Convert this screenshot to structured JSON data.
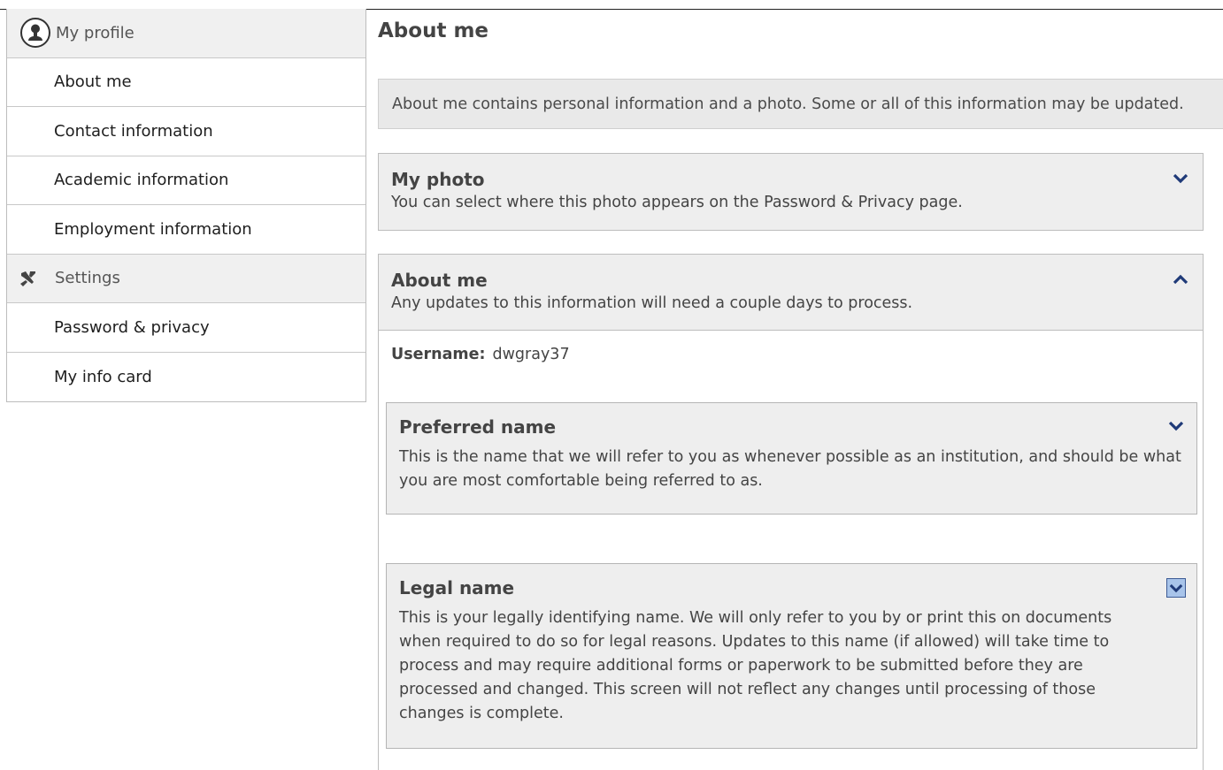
{
  "sidebar": {
    "profile_header": "My profile",
    "items": [
      {
        "label": "About me"
      },
      {
        "label": "Contact information"
      },
      {
        "label": "Academic information"
      },
      {
        "label": "Employment information"
      }
    ],
    "settings_header": "Settings",
    "settings_items": [
      {
        "label": "Password & privacy"
      },
      {
        "label": "My info card"
      }
    ]
  },
  "main": {
    "title": "About me",
    "banner": "About me contains personal information and a photo. Some or all of this information may be updated.",
    "photo_panel": {
      "title": "My photo",
      "description": "You can select where this photo appears on the Password & Privacy page.",
      "state": "collapsed"
    },
    "about_panel": {
      "title": "About me",
      "description": "Any updates to this information will need a couple days to process.",
      "state": "expanded",
      "username_label": "Username:",
      "username_value": "dwgray37",
      "preferred_name": {
        "title": "Preferred name",
        "description": "This is the name that we will refer to you as whenever possible as an institution, and should be what you are most comfortable being referred to as.",
        "state": "collapsed"
      },
      "legal_name": {
        "title": "Legal name",
        "description": "This is your legally identifying name. We will only refer to you by or print this on documents when required to do so for legal reasons. Updates to this name (if allowed) will take time to process and may require additional forms or paperwork to be submitted before they are processed and changed. This screen will not reflect any changes until processing of those changes is complete.",
        "state": "collapsed-focused"
      }
    }
  },
  "colors": {
    "chevron": "#1f3a78",
    "panel_bg": "#eeeeee",
    "focus_box": "#a8c4ea"
  },
  "icons": {
    "profile": "user-circle-icon",
    "settings": "tools-icon",
    "expand": "chevron-down-icon",
    "collapse": "chevron-up-icon"
  }
}
